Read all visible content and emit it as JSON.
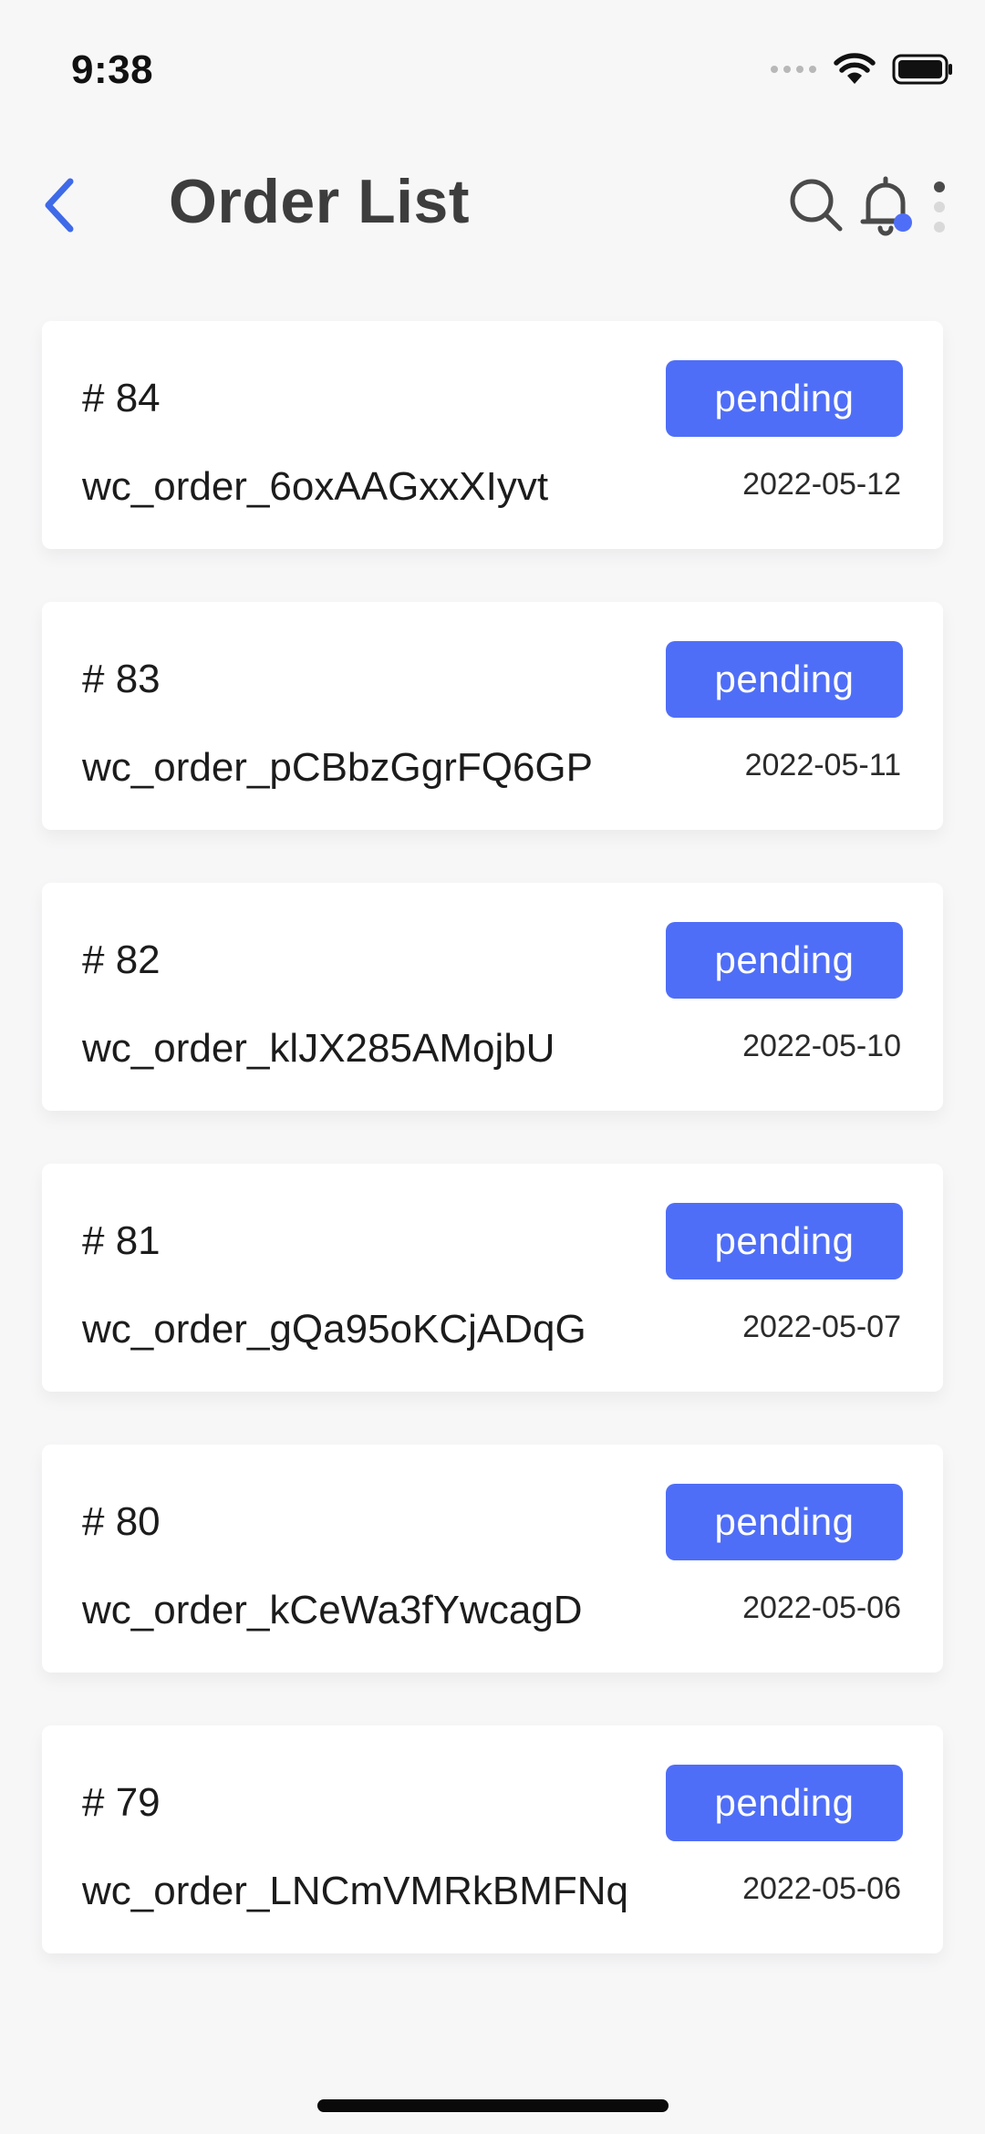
{
  "status_bar": {
    "time": "9:38"
  },
  "header": {
    "title": "Order List",
    "back_icon": "chevron-left-icon",
    "search_icon": "search-icon",
    "bell_icon": "bell-icon",
    "more_icon": "more-vertical-icon"
  },
  "colors": {
    "accent": "#4f6ef7",
    "back_icon": "#3f6ae8",
    "background": "#f7f7f8",
    "card": "#ffffff"
  },
  "orders": [
    {
      "number": "# 84",
      "key": "wc_order_6oxAAGxxXIyvt",
      "date": "2022-05-12",
      "status": "pending"
    },
    {
      "number": "# 83",
      "key": "wc_order_pCBbzGgrFQ6GP",
      "date": "2022-05-11",
      "status": "pending"
    },
    {
      "number": "# 82",
      "key": "wc_order_klJX285AMojbU",
      "date": "2022-05-10",
      "status": "pending"
    },
    {
      "number": "# 81",
      "key": "wc_order_gQa95oKCjADqG",
      "date": "2022-05-07",
      "status": "pending"
    },
    {
      "number": "# 80",
      "key": "wc_order_kCeWa3fYwcagD",
      "date": "2022-05-06",
      "status": "pending"
    },
    {
      "number": "# 79",
      "key": "wc_order_LNCmVMRkBMFNq",
      "date": "2022-05-06",
      "status": "pending"
    }
  ]
}
